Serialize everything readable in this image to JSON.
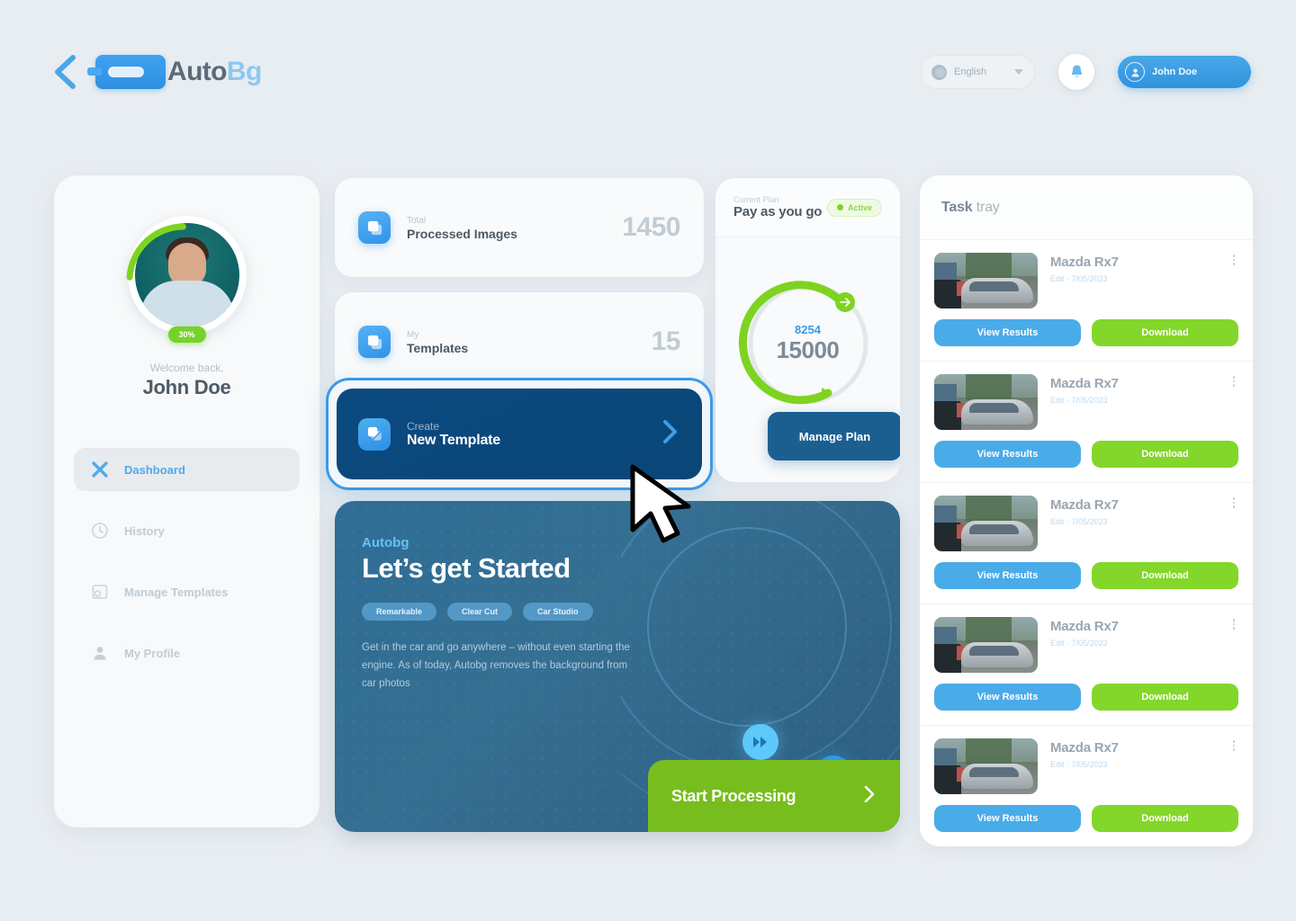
{
  "header": {
    "back_icon": "chevron-left-icon",
    "brand_name": "Auto",
    "brand_accent": "Bg",
    "language": {
      "icon": "globe-icon",
      "value": "English",
      "chevron": "chevron-down-icon"
    },
    "notifications_icon": "bell-icon",
    "user": {
      "avatar_icon": "user-avatar-icon",
      "name": "John Doe"
    }
  },
  "sidebar": {
    "avatar_badge": "30%",
    "welcome_sub": "Welcome back,",
    "welcome_name": "John Doe",
    "items": [
      {
        "label": "Dashboard",
        "icon": "dashboard-icon",
        "active": true
      },
      {
        "label": "History",
        "icon": "clock-icon",
        "active": false
      },
      {
        "label": "Manage Templates",
        "icon": "templates-icon",
        "active": false
      },
      {
        "label": "My Profile",
        "icon": "person-icon",
        "active": false
      }
    ]
  },
  "stats": [
    {
      "sub": "Total",
      "title": "Processed Images",
      "value": "1450",
      "icon": "image-stack-icon"
    },
    {
      "sub": "My",
      "title": "Templates",
      "value": "15",
      "icon": "image-stack-icon"
    }
  ],
  "create_template": {
    "sub": "Create",
    "title": "New Template",
    "icon": "copy-image-icon",
    "chevron": "chevron-right-icon",
    "highlighted": true
  },
  "plan": {
    "sub": "Current Plan",
    "name": "Pay as you go",
    "badge": "Active",
    "gauge": {
      "used": "8254",
      "total": "15000",
      "percent": 55
    },
    "button": "Manage Plan"
  },
  "banner": {
    "eyebrow": "Autobg",
    "title": "Let’s get Started",
    "pills": [
      "Remarkable",
      "Clear Cut",
      "Car Studio"
    ],
    "description": "Get in the car and go anywhere – without even starting the engine. As of today, Autobg  removes the background from car photos",
    "floating_icons": [
      "fast-forward-icon",
      "camera-icon",
      "cloud-upload-icon"
    ],
    "cta": {
      "label": "Start Processing",
      "chevron": "chevron-right-icon"
    }
  },
  "task_tray": {
    "title_bold": "Task",
    "title_thin": " tray",
    "tasks": [
      {
        "name": "Mazda Rx7",
        "meta": "Edit · 7/05/2023",
        "view_label": "View Results",
        "download_label": "Download",
        "menu_icon": "kebab-menu-icon"
      },
      {
        "name": "Mazda Rx7",
        "meta": "Edit · 7/05/2023",
        "view_label": "View Results",
        "download_label": "Download",
        "menu_icon": "kebab-menu-icon"
      },
      {
        "name": "Mazda Rx7",
        "meta": "Edit · 7/05/2023",
        "view_label": "View Results",
        "download_label": "Download",
        "menu_icon": "kebab-menu-icon"
      },
      {
        "name": "Mazda Rx7",
        "meta": "Edit · 7/05/2023",
        "view_label": "View Results",
        "download_label": "Download",
        "menu_icon": "kebab-menu-icon"
      },
      {
        "name": "Mazda Rx7",
        "meta": "Edit · 7/05/2023",
        "view_label": "View Results",
        "download_label": "Download",
        "menu_icon": "kebab-menu-icon"
      }
    ]
  },
  "colors": {
    "background": "#e8edf1",
    "primary_blue": "#3a9ae8",
    "dark_blue": "#0b4a80",
    "green": "#7ed321",
    "card": "#f8fafb"
  },
  "cursor": {
    "icon": "mouse-pointer-icon"
  }
}
